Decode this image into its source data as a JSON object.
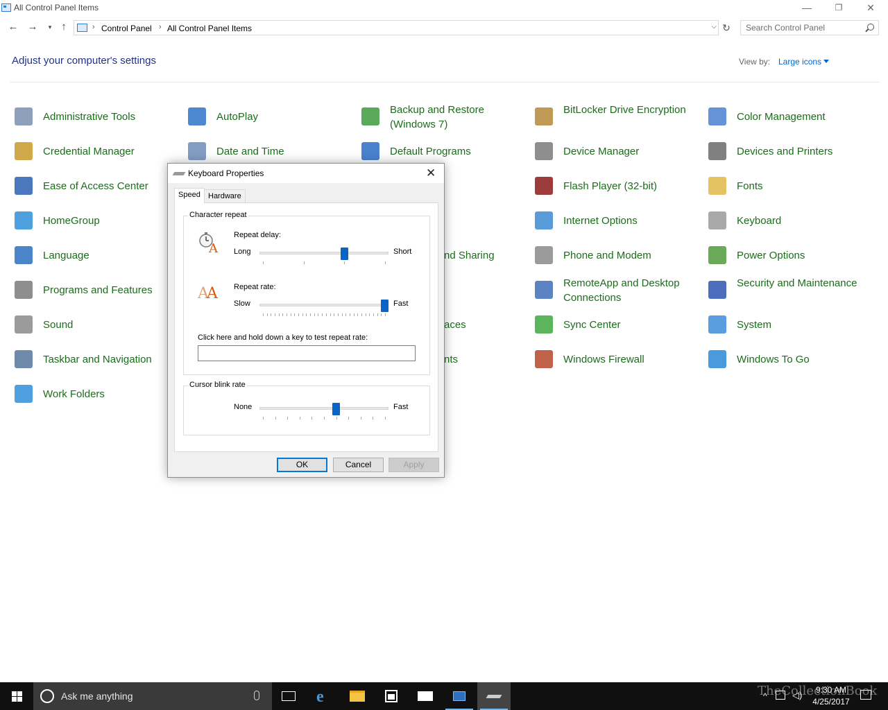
{
  "window": {
    "title": "All Control Panel Items",
    "minimize": "—",
    "restore": "❐",
    "close": "✕"
  },
  "address": {
    "crumbs": [
      "Control Panel",
      "All Control Panel Items"
    ],
    "search_placeholder": "Search Control Panel"
  },
  "main": {
    "heading": "Adjust your computer's settings",
    "view_by_label": "View by:",
    "view_by_value": "Large icons"
  },
  "items": [
    [
      "Administrative Tools",
      "AutoPlay",
      "Backup and Restore (Windows 7)",
      "BitLocker Drive Encryption",
      "Color Management"
    ],
    [
      "Credential Manager",
      "Date and Time",
      "Default Programs",
      "Device Manager",
      "Devices and Printers"
    ],
    [
      "Ease of Access Center",
      "",
      "",
      "Flash Player (32-bit)",
      "Fonts"
    ],
    [
      "HomeGroup",
      "",
      "",
      "Internet Options",
      "Keyboard"
    ],
    [
      "Language",
      "",
      "nd Sharing",
      "Phone and Modem",
      "Power Options"
    ],
    [
      "Programs and Features",
      "",
      "",
      "RemoteApp and Desktop Connections",
      "Security and Maintenance"
    ],
    [
      "Sound",
      "",
      "aces",
      "Sync Center",
      "System"
    ],
    [
      "Taskbar and Navigation",
      "",
      "nts",
      "Windows Firewall",
      "Windows To Go"
    ],
    [
      "Work Folders",
      "",
      "",
      "",
      ""
    ]
  ],
  "dialog": {
    "title": "Keyboard Properties",
    "close": "✕",
    "tabs": [
      "Speed",
      "Hardware"
    ],
    "active_tab": "Speed",
    "char_repeat": {
      "label": "Character repeat",
      "delay_label": "Repeat delay:",
      "delay_min": "Long",
      "delay_max": "Short",
      "delay_value": 0.667,
      "rate_label": "Repeat rate:",
      "rate_min": "Slow",
      "rate_max": "Fast",
      "rate_value": 1.0,
      "test_label": "Click here and hold down a key to test repeat rate:",
      "test_value": ""
    },
    "cursor_blink": {
      "label": "Cursor blink rate",
      "min": "None",
      "max": "Fast",
      "value": 0.6
    },
    "buttons": {
      "ok": "OK",
      "cancel": "Cancel",
      "apply": "Apply"
    }
  },
  "taskbar": {
    "search_placeholder": "Ask me anything",
    "time": "9:30 AM",
    "date": "4/25/2017",
    "watermark": "TheCollectionBook"
  }
}
